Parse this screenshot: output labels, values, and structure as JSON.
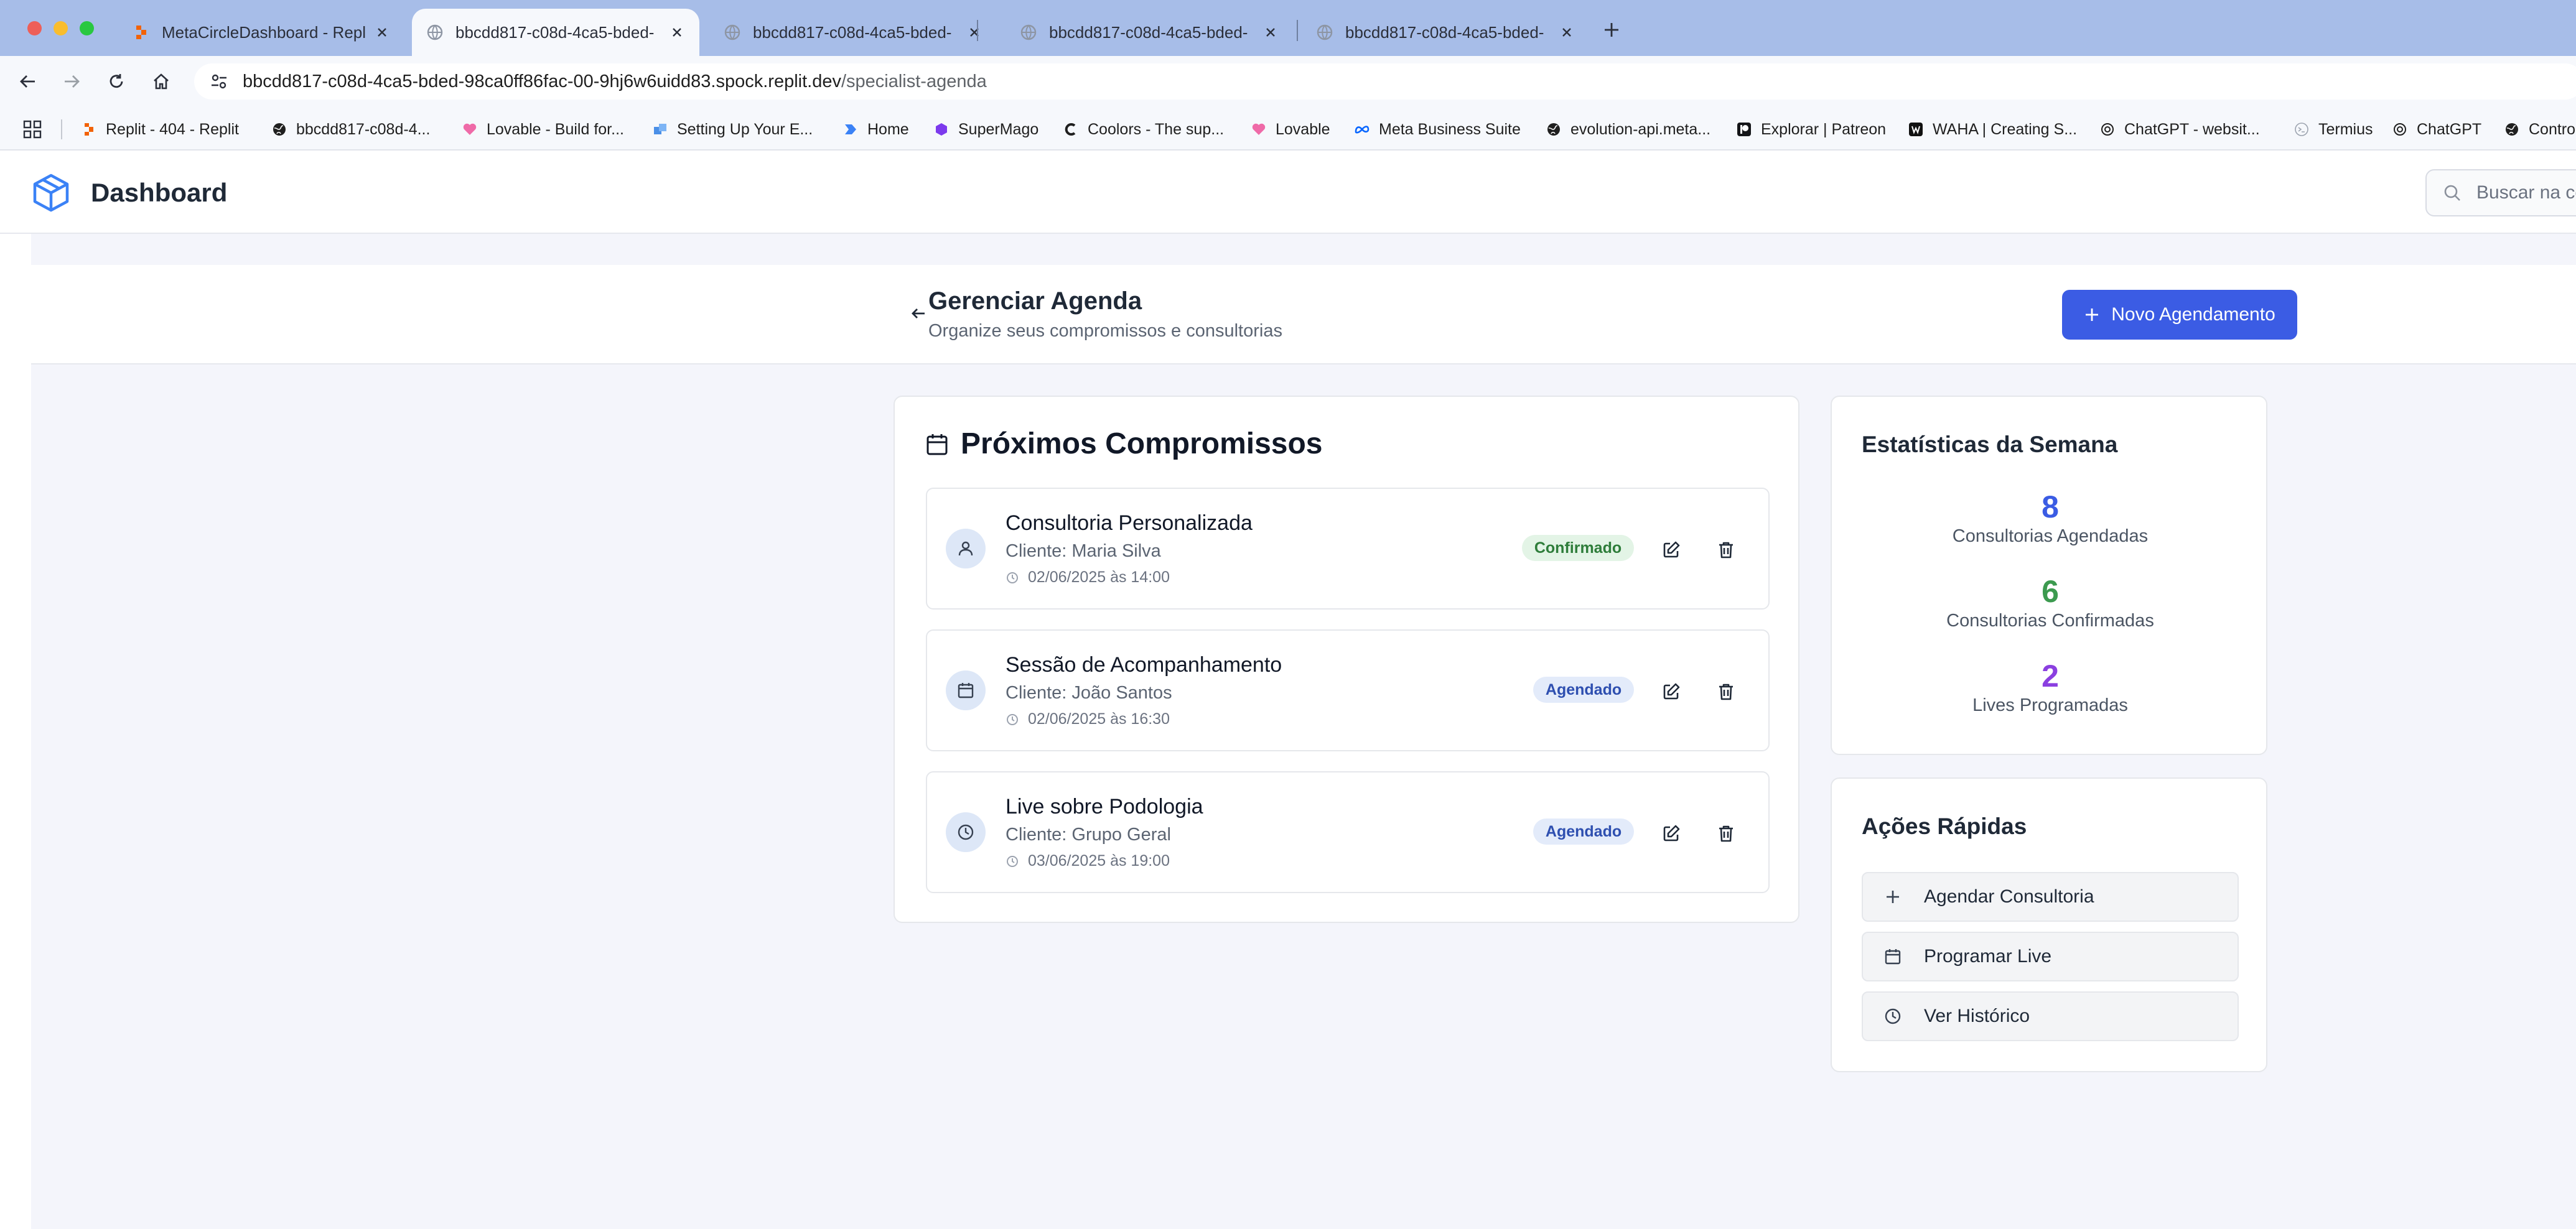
{
  "browser": {
    "tabs": [
      {
        "title": "MetaCircleDashboard - Replit",
        "active": false
      },
      {
        "title": "bbcdd817-c08d-4ca5-bded-",
        "active": true
      },
      {
        "title": "bbcdd817-c08d-4ca5-bded-",
        "active": false
      },
      {
        "title": "bbcdd817-c08d-4ca5-bded-",
        "active": false
      },
      {
        "title": "bbcdd817-c08d-4ca5-bded-",
        "active": false
      }
    ],
    "url_host": "bbcdd817-c08d-4ca5-bded-98ca0ff86fac-00-9hj6w6uidd83.spock.replit.dev",
    "url_path": "/specialist-agenda",
    "bookmarks": [
      {
        "label": "Replit - 404 - Replit",
        "icon": "replit-icon"
      },
      {
        "label": "bbcdd817-c08d-4...",
        "icon": "globe-icon"
      },
      {
        "label": "Lovable - Build for...",
        "icon": "lovable-heart-icon"
      },
      {
        "label": "Setting Up Your E...",
        "icon": "squares-icon"
      },
      {
        "label": "Home",
        "icon": "home-arrow-icon"
      },
      {
        "label": "SuperMago",
        "icon": "hexagon-icon"
      },
      {
        "label": "Coolors - The sup...",
        "icon": "coolors-icon"
      },
      {
        "label": "Lovable",
        "icon": "lovable-heart-icon"
      },
      {
        "label": "Meta Business Suite",
        "icon": "meta-icon"
      },
      {
        "label": "evolution-api.meta...",
        "icon": "globe-icon"
      },
      {
        "label": "Explorar | Patreon",
        "icon": "patreon-icon"
      },
      {
        "label": "WAHA | Creating S...",
        "icon": "waha-icon"
      },
      {
        "label": "ChatGPT - websit...",
        "icon": "openai-icon"
      },
      {
        "label": "Termius",
        "icon": "termius-icon"
      },
      {
        "label": "ChatGPT",
        "icon": "openai-icon"
      },
      {
        "label": "Contro",
        "icon": "globe-icon"
      }
    ]
  },
  "app": {
    "title": "Dashboard",
    "search_placeholder": "Buscar na co"
  },
  "page": {
    "title": "Gerenciar Agenda",
    "subtitle": "Organize seus compromissos e consultorias",
    "new_button": "Novo Agendamento"
  },
  "appointments": {
    "heading": "Próximos Compromissos",
    "items": [
      {
        "title": "Consultoria Personalizada",
        "client": "Cliente: Maria Silva",
        "datetime": "02/06/2025 às 14:00",
        "status": "Confirmado",
        "status_type": "ok",
        "icon": "user-icon"
      },
      {
        "title": "Sessão de Acompanhamento",
        "client": "Cliente: João Santos",
        "datetime": "02/06/2025 às 16:30",
        "status": "Agendado",
        "status_type": "sched",
        "icon": "calendar-icon"
      },
      {
        "title": "Live sobre Podologia",
        "client": "Cliente: Grupo Geral",
        "datetime": "03/06/2025 às 19:00",
        "status": "Agendado",
        "status_type": "sched",
        "icon": "clock-icon"
      }
    ]
  },
  "stats": {
    "heading": "Estatísticas da Semana",
    "items": [
      {
        "value": "8",
        "label": "Consultorias Agendadas",
        "color": "#3b5ce4"
      },
      {
        "value": "6",
        "label": "Consultorias Confirmadas",
        "color": "#3c9a4f"
      },
      {
        "value": "2",
        "label": "Lives Programadas",
        "color": "#8b3fe0"
      }
    ]
  },
  "quick_actions": {
    "heading": "Ações Rápidas",
    "items": [
      {
        "label": "Agendar Consultoria",
        "icon": "plus-icon"
      },
      {
        "label": "Programar Live",
        "icon": "calendar-icon"
      },
      {
        "label": "Ver Histórico",
        "icon": "clock-icon"
      }
    ]
  },
  "colors": {
    "primary": "#3b5ce4",
    "tabbar": "#a7bde8",
    "page_background": "#f4f5fb",
    "confirmed_badge": "#e3f4e6",
    "scheduled_badge": "#e3ebfa"
  }
}
